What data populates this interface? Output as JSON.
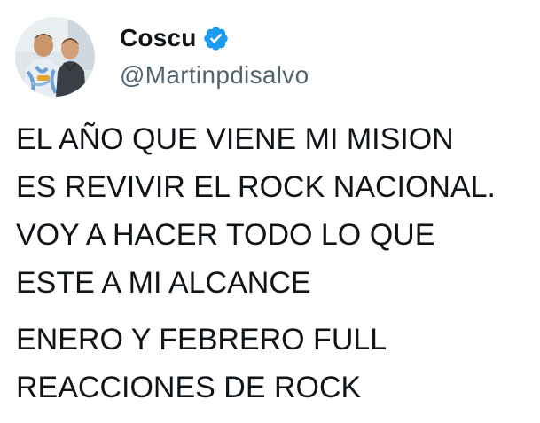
{
  "tweet": {
    "author": {
      "display_name": "Coscu",
      "handle": "@Martinpdisalvo",
      "verified": true,
      "verified_color": "#1d9bf0"
    },
    "paragraphs": [
      {
        "lines": [
          "EL AÑO QUE VIENE MI MISION",
          "ES REVIVIR EL ROCK NACIONAL.",
          "VOY A HACER TODO LO QUE",
          "ESTE A MI ALCANCE"
        ]
      },
      {
        "lines": [
          "ENERO Y FEBRERO FULL",
          "REACCIONES DE ROCK"
        ]
      }
    ]
  },
  "colors": {
    "text": "#0f1419",
    "secondary_text": "#536471",
    "background": "#ffffff"
  }
}
